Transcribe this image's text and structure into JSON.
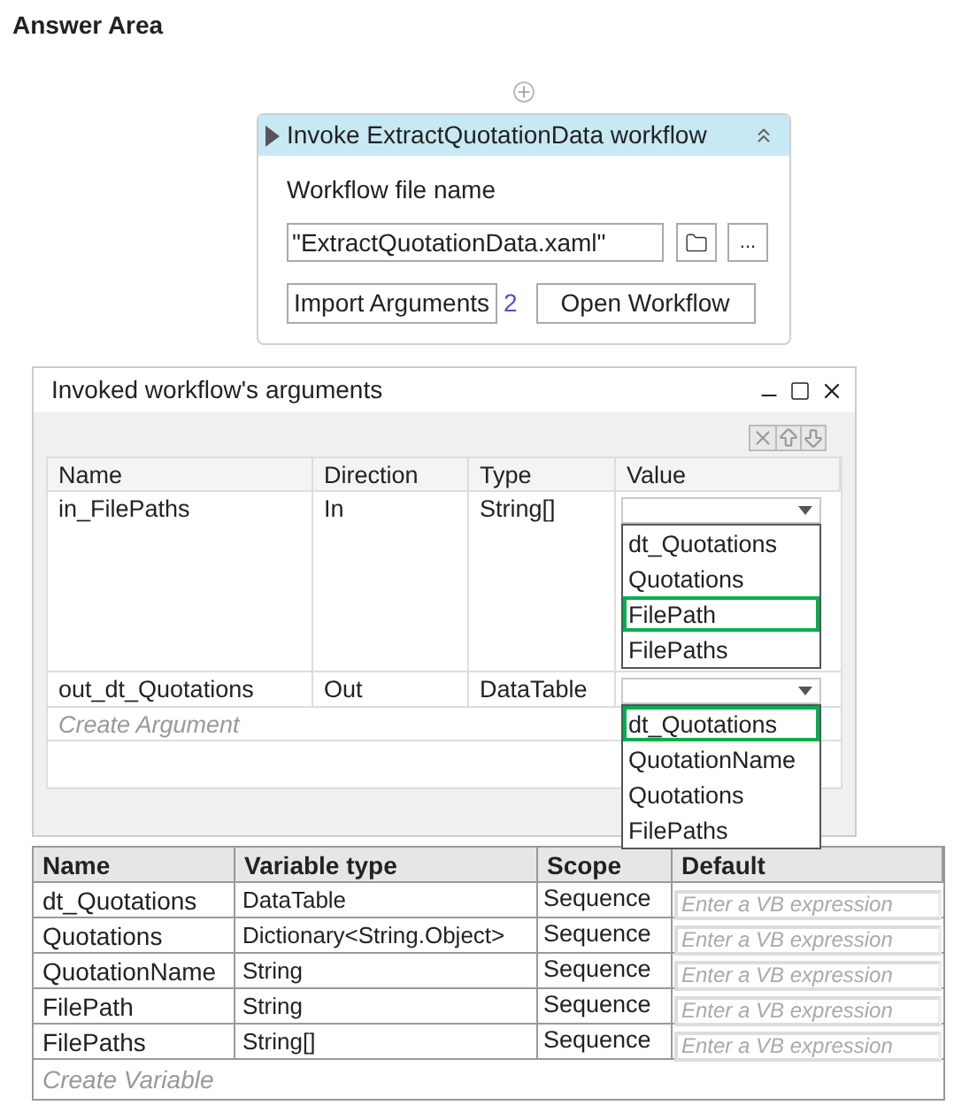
{
  "title": "Answer Area",
  "activity": {
    "title": "Invoke ExtractQuotationData workflow",
    "field_label": "Workflow file name",
    "file_name": "\"ExtractQuotationData.xaml\"",
    "more_button": "...",
    "import_button": "Import Arguments",
    "argument_count": "2",
    "open_button": "Open Workflow"
  },
  "dialog": {
    "title": "Invoked workflow's arguments",
    "columns": [
      "Name",
      "Direction",
      "Type",
      "Value"
    ],
    "rows": [
      {
        "name": "in_FilePaths",
        "direction": "In",
        "type": "String[]",
        "options": [
          {
            "label": "dt_Quotations",
            "selected": false
          },
          {
            "label": "Quotations",
            "selected": false
          },
          {
            "label": "FilePath",
            "selected": true
          },
          {
            "label": "FilePaths",
            "selected": false
          }
        ]
      },
      {
        "name": "out_dt_Quotations",
        "direction": "Out",
        "type": "DataTable",
        "options": [
          {
            "label": "dt_Quotations",
            "selected": true
          },
          {
            "label": "QuotationName",
            "selected": false
          },
          {
            "label": "Quotations",
            "selected": false
          },
          {
            "label": "FilePaths",
            "selected": false
          }
        ]
      }
    ],
    "create_placeholder": "Create Argument"
  },
  "variables": {
    "columns": [
      "Name",
      "Variable type",
      "Scope",
      "Default"
    ],
    "rows": [
      {
        "name": "dt_Quotations",
        "type": "DataTable",
        "scope": "Sequence",
        "default_placeholder": "Enter a VB expression"
      },
      {
        "name": "Quotations",
        "type": "Dictionary<String.Object>",
        "scope": "Sequence",
        "default_placeholder": "Enter a VB expression"
      },
      {
        "name": "QuotationName",
        "type": "String",
        "scope": "Sequence",
        "default_placeholder": "Enter a VB expression"
      },
      {
        "name": "FilePath",
        "type": "String",
        "scope": "Sequence",
        "default_placeholder": "Enter a VB expression"
      },
      {
        "name": "FilePaths",
        "type": "String[]",
        "scope": "Sequence",
        "default_placeholder": "Enter a VB expression"
      }
    ],
    "create_placeholder": "Create Variable"
  }
}
